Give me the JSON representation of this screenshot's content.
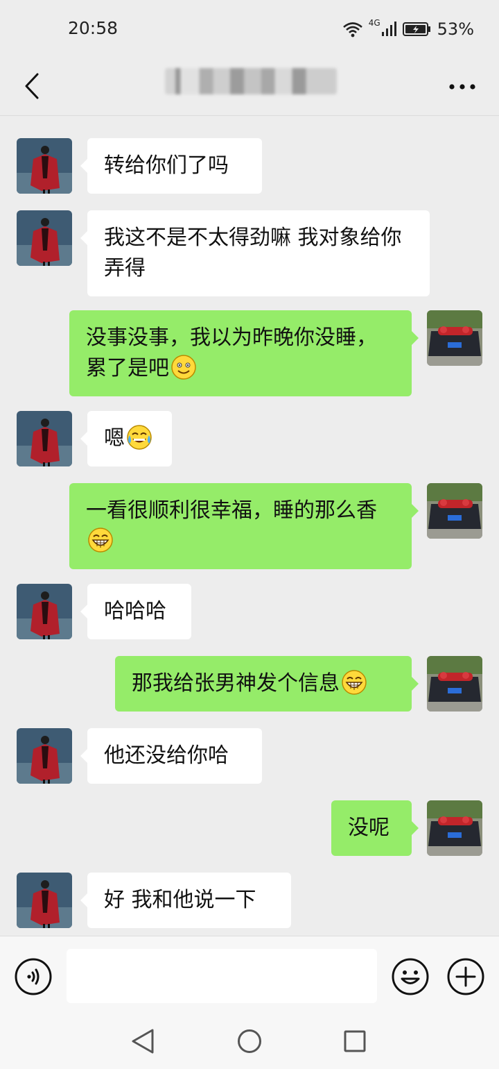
{
  "status_bar": {
    "time": "20:58",
    "network": "4G",
    "battery": "53%"
  },
  "header": {
    "title": "",
    "more_label": "···"
  },
  "colors": {
    "background": "#ededed",
    "bubble_incoming": "#ffffff",
    "bubble_outgoing": "#95ec69"
  },
  "messages": [
    {
      "side": "left",
      "text": "转给你们了吗",
      "emoji": ""
    },
    {
      "side": "left",
      "text": "我这不是不太得劲嘛 我对象给你弄得",
      "emoji": ""
    },
    {
      "side": "right",
      "text": "没事没事，我以为昨晚你没睡，累了是吧",
      "emoji": "smile-emoji"
    },
    {
      "side": "left",
      "text": "嗯",
      "emoji": "tears-of-joy-emoji"
    },
    {
      "side": "right",
      "text": "一看很顺利很幸福，睡的那么香",
      "emoji": "grin-emoji"
    },
    {
      "side": "left",
      "text": "哈哈哈",
      "emoji": ""
    },
    {
      "side": "right",
      "text": "那我给张男神发个信息",
      "emoji": "grin-emoji"
    },
    {
      "side": "left",
      "text": "他还没给你哈",
      "emoji": ""
    },
    {
      "side": "right",
      "text": "没呢",
      "emoji": ""
    },
    {
      "side": "left",
      "text": "好 我和他说一下",
      "emoji": ""
    }
  ],
  "input_bar": {
    "placeholder": "",
    "voice_icon": "voice-icon",
    "emoji_icon": "emoji-icon",
    "plus_icon": "plus-icon"
  },
  "nav_bar": {
    "back_icon": "nav-back-icon",
    "home_icon": "nav-home-icon",
    "recent_icon": "nav-recent-icon"
  }
}
